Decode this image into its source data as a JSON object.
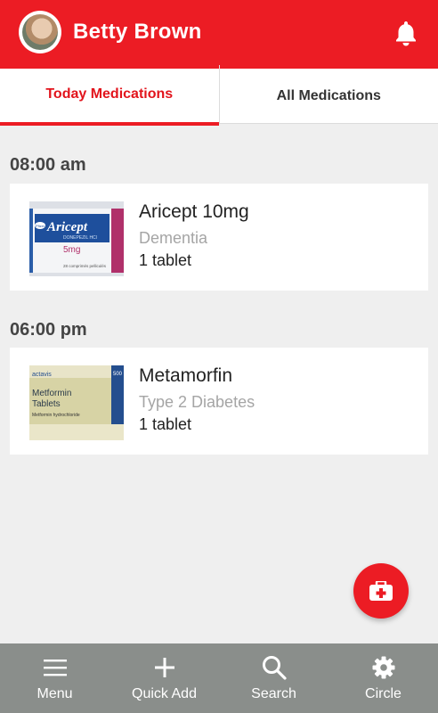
{
  "header": {
    "user_name": "Betty Brown"
  },
  "tabs": [
    {
      "label": "Today Medications",
      "active": true
    },
    {
      "label": "All Medications",
      "active": false
    }
  ],
  "schedule": [
    {
      "time": "08:00 am",
      "medication": {
        "name": "Aricept 10mg",
        "condition": "Dementia",
        "dose": "1 tablet",
        "box_text": {
          "brand": "Aricept",
          "generic": "DONEPEZIL HCl",
          "strength": "5mg",
          "maker": "Pfizer",
          "count": "28 comprimés pelliculés"
        }
      }
    },
    {
      "time": "06:00 pm",
      "medication": {
        "name": "Metamorfin",
        "condition": "Type 2 Diabetes",
        "dose": "1 tablet",
        "box_text": {
          "brand": "Metformin",
          "form": "Tablets",
          "generic": "Metformin hydrochloride",
          "strength": "500",
          "maker": "actavis"
        }
      }
    }
  ],
  "bottom_nav": [
    {
      "label": "Menu",
      "icon": "menu-icon"
    },
    {
      "label": "Quick Add",
      "icon": "plus-icon"
    },
    {
      "label": "Search",
      "icon": "search-icon"
    },
    {
      "label": "Circle",
      "icon": "gear-icon"
    }
  ],
  "colors": {
    "primary": "#ec1c24",
    "nav_bg": "#8a8e8b",
    "background": "#efefef"
  }
}
